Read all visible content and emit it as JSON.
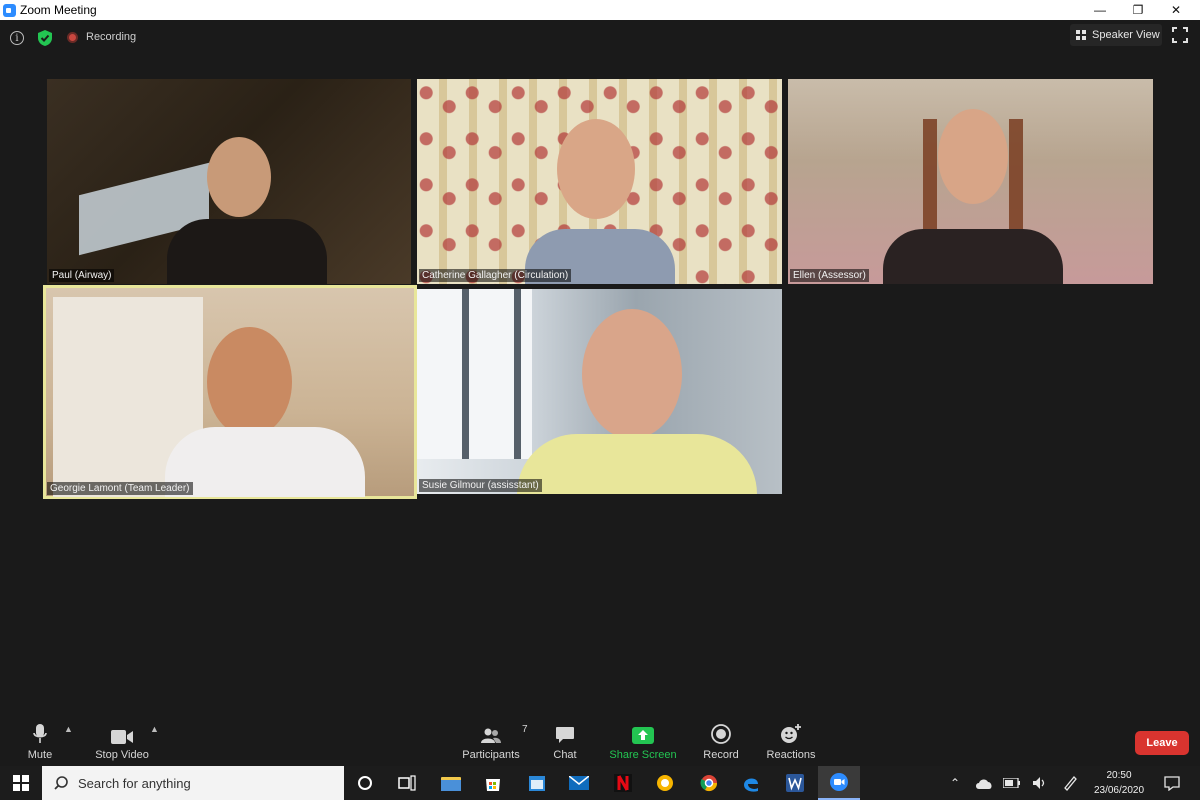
{
  "window": {
    "title": "Zoom Meeting",
    "minimize": "—",
    "restore": "❐",
    "close": "✕"
  },
  "top_bar": {
    "info_glyph": "i",
    "recording_label": "Recording",
    "view_button_label": "Speaker View"
  },
  "participants": [
    {
      "name": "Paul (Airway)",
      "active_speaker": false
    },
    {
      "name": "Catherine Gallagher (Circulation)",
      "active_speaker": false
    },
    {
      "name": "Ellen (Assessor)",
      "active_speaker": false
    },
    {
      "name": "Georgie Lamont (Team Leader)",
      "active_speaker": true
    },
    {
      "name": "Susie Gilmour (assisstant)",
      "active_speaker": false
    }
  ],
  "toolbar": {
    "mute_label": "Mute",
    "stop_video_label": "Stop Video",
    "participants_label": "Participants",
    "participants_count": "7",
    "chat_label": "Chat",
    "share_screen_label": "Share Screen",
    "record_label": "Record",
    "reactions_label": "Reactions",
    "leave_label": "Leave"
  },
  "taskbar": {
    "search_placeholder": "Search for anything",
    "time": "20:50",
    "date": "23/06/2020",
    "pinned_apps": [
      "cortana-icon",
      "task-view-icon",
      "file-explorer-icon",
      "store-icon",
      "calendar-icon",
      "mail-icon",
      "netflix-icon",
      "norton-icon",
      "chrome-icon",
      "edge-icon",
      "word-icon",
      "zoom-icon"
    ]
  },
  "colors": {
    "accent_share": "#23c552",
    "leave": "#d9342f",
    "active_speaker_border": "#e8e69a",
    "zoom_blue": "#2d8cff"
  }
}
